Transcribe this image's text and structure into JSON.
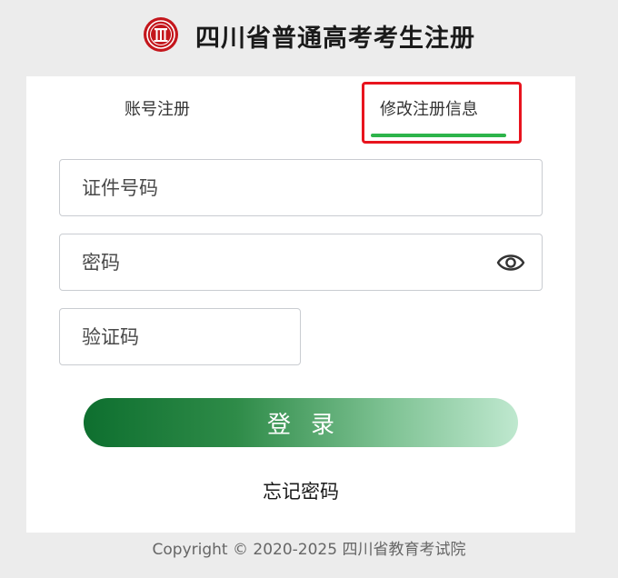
{
  "header": {
    "title": "四川省普通高考考生注册",
    "logo_icon": "emblem-seal-icon",
    "logo_color": "#c4161c"
  },
  "tabs": [
    {
      "label": "账号注册",
      "active": false
    },
    {
      "label": "修改注册信息",
      "active": true
    }
  ],
  "form": {
    "id_placeholder": "证件号码",
    "password_placeholder": "密码",
    "password_toggle_icon": "eye-icon",
    "captcha_placeholder": "验证码"
  },
  "login_button": {
    "label": "登录"
  },
  "forgot_password": "忘记密码",
  "footer": {
    "copyright": "Copyright © 2020-2025 四川省教育考试院"
  },
  "colors": {
    "accent_green": "#2db44a",
    "highlight_red": "#e8141e",
    "button_gradient_start": "#0e6f2f",
    "button_gradient_end": "#bfe8cf"
  }
}
